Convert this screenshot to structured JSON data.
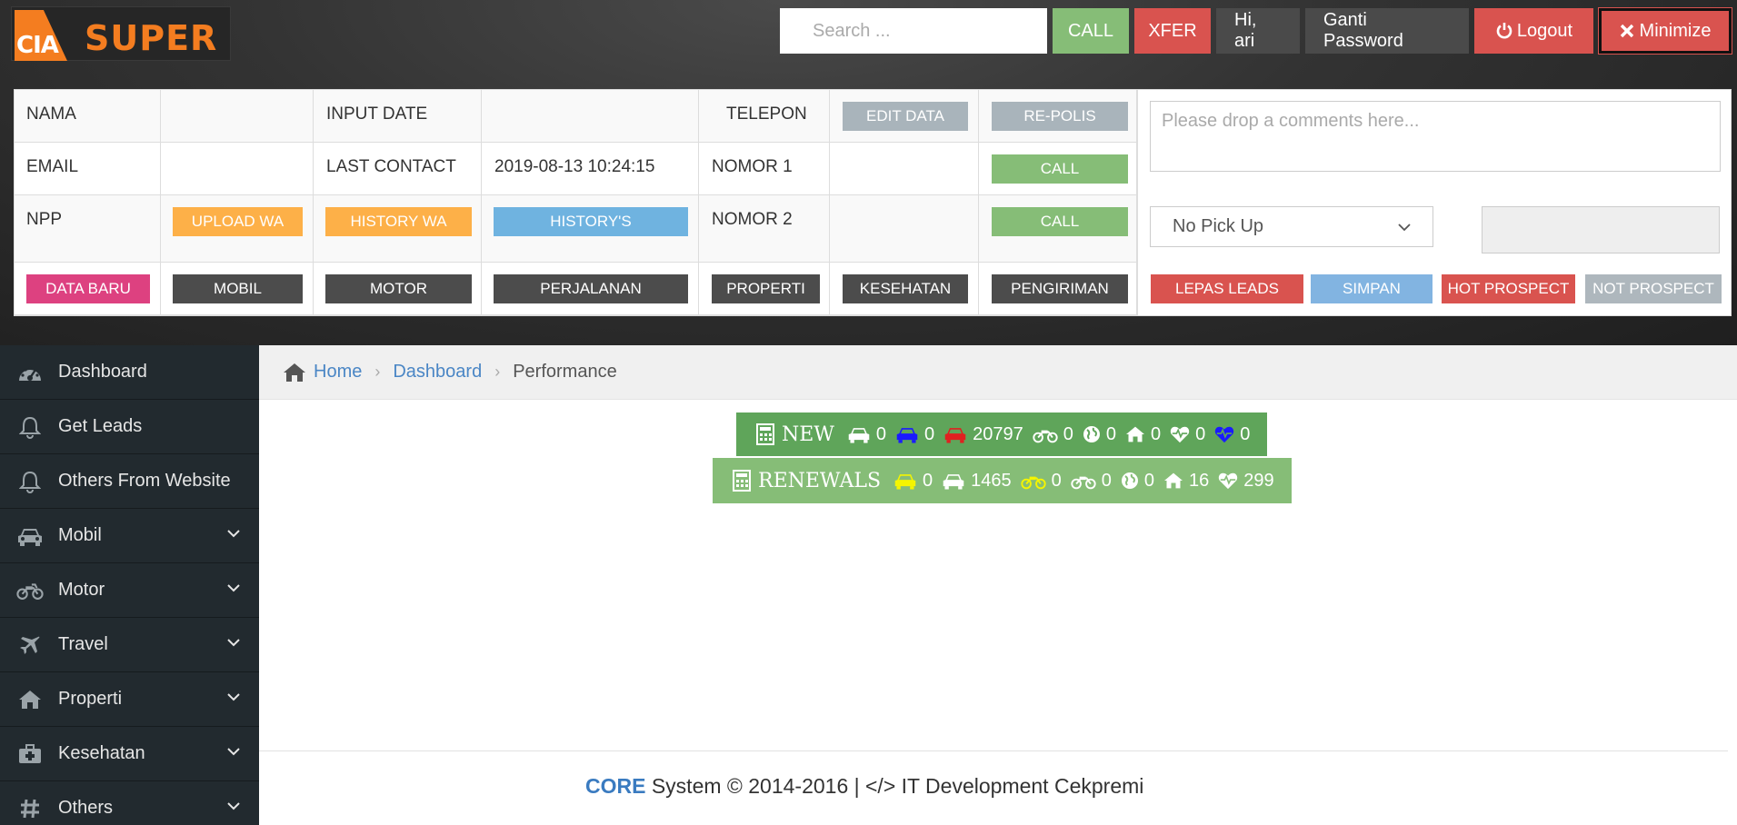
{
  "header": {
    "logo": {
      "badge": "CIA",
      "brand": "SUPER"
    },
    "search": {
      "placeholder": "Search ..."
    },
    "buttons": {
      "call": "CALL",
      "xfer": "XFER",
      "greeting": "Hi, ari",
      "change_password": "Ganti Password",
      "logout": "Logout",
      "minimize": "Minimize"
    }
  },
  "customer_panel": {
    "labels": {
      "nama": "NAMA",
      "email": "EMAIL",
      "npp": "NPP",
      "input_date": "INPUT DATE",
      "last_contact": "LAST CONTACT",
      "telepon": "TELEPON",
      "nomor1": "NOMOR 1",
      "nomor2": "NOMOR 2"
    },
    "values": {
      "last_contact": "2019-08-13 10:24:15"
    },
    "buttons": {
      "edit_data": "EDIT DATA",
      "re_polis": "RE-POLIS",
      "call_1": "CALL",
      "call_2": "CALL",
      "upload_wa": "UPLOAD WA",
      "history_wa": "HISTORY WA",
      "historys": "HISTORY'S",
      "data_baru": "DATA BARU",
      "mobil": "MOBIL",
      "motor": "MOTOR",
      "perjalanan": "PERJALANAN",
      "properti": "PROPERTI",
      "kesehatan": "KESEHATAN",
      "pengiriman": "PENGIRIMAN",
      "lepas_leads": "LEPAS LEADS",
      "simpan": "SIMPAN",
      "hot_prospect": "HOT PROSPECT",
      "not_prospect": "NOT PROSPECT"
    },
    "comment": {
      "placeholder": "Please drop a comments here..."
    },
    "status_select": {
      "value": "No Pick Up"
    }
  },
  "sidebar": {
    "items": [
      {
        "label": "Dashboard",
        "icon": "dashboard-icon"
      },
      {
        "label": "Get Leads",
        "icon": "bell-icon"
      },
      {
        "label": "Others From Website",
        "icon": "bell-icon"
      },
      {
        "label": "Mobil",
        "icon": "car-icon"
      },
      {
        "label": "Motor",
        "icon": "motorcycle-icon"
      },
      {
        "label": "Travel",
        "icon": "plane-icon"
      },
      {
        "label": "Properti",
        "icon": "home-icon"
      },
      {
        "label": "Kesehatan",
        "icon": "medkit-icon"
      },
      {
        "label": "Others",
        "icon": "hashtag-icon"
      }
    ]
  },
  "breadcrumb": {
    "home": "Home",
    "dashboard": "Dashboard",
    "current": "Performance"
  },
  "stats": {
    "new": {
      "title": "NEW",
      "counts": [
        "0",
        "0",
        "20797",
        "0",
        "0",
        "0",
        "0",
        "0"
      ]
    },
    "renewals": {
      "title": "RENEWALS",
      "counts": [
        "0",
        "1465",
        "0",
        "0",
        "0",
        "16",
        "299"
      ]
    }
  },
  "footer": {
    "core": "CORE",
    "text": " System © 2014-2016 | </> IT Development Cekpremi"
  },
  "colors": {
    "accent_orange": "#f47d20",
    "green": "#86bd77",
    "red": "#d9534f",
    "sidebar_bg": "#222a2f",
    "link_blue": "#4a86c5"
  }
}
